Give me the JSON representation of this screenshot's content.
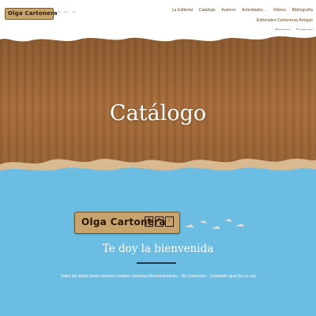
{
  "brand": {
    "name": "Olga Cartonera"
  },
  "nav": {
    "items": [
      "La Editorial",
      "Catálogo",
      "Autores",
      "Actividades",
      "Videos",
      "Bibliografía",
      "Editoriales Cartoneras Amigas",
      "Noticias",
      "Contacto"
    ]
  },
  "hero": {
    "title": "Catálogo"
  },
  "welcome": {
    "title": "Te doy la bienvenida",
    "license": "Todos los títulos tienen licencia creative commons Reconocimiento – No Comercial – Compartir Igual (by-nc-sa)"
  },
  "colors": {
    "header_bg": "#ffffff",
    "sky": "#6cbde3",
    "cardboard": "#a86f3e",
    "rule": "#1f3850"
  }
}
